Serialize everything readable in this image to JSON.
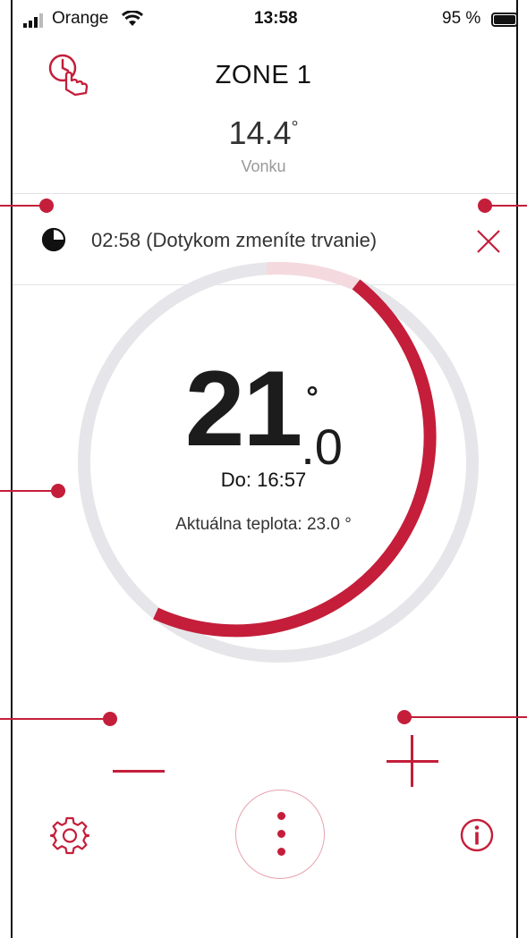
{
  "status_bar": {
    "carrier": "Orange",
    "time": "13:58",
    "battery": "95 %"
  },
  "header": {
    "zone_title": "ZONE 1",
    "outdoor_temp": "14.4",
    "outdoor_deg": "°",
    "outdoor_label": "Vonku"
  },
  "override": {
    "text": "02:58 (Dotykom zmeníte trvanie)",
    "icon": "half-clock-icon",
    "close_icon": "close-icon"
  },
  "dial": {
    "setpoint_int": "21",
    "setpoint_frac": ".0",
    "setpoint_deg": "°",
    "until": "Do: 16:57",
    "current_temp": "Aktuálna teplota: 23.0 °"
  },
  "icons": {
    "schedule": "clock-touch-icon",
    "settings": "gear-icon",
    "menu": "more-vertical-icon",
    "info": "info-icon"
  },
  "colors": {
    "accent": "#c41e3a",
    "track": "#e6e6ea",
    "divider": "#e4e4e4"
  }
}
